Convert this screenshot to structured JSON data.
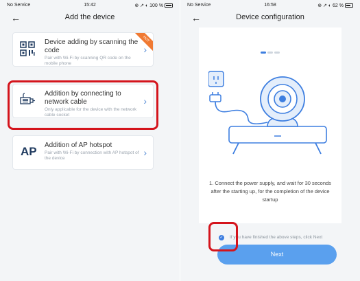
{
  "left_screen": {
    "status": {
      "carrier": "No Service",
      "time": "15:42",
      "battery": "100 %"
    },
    "nav": {
      "back_icon": "back-arrow-icon",
      "title": "Add the device"
    },
    "options": [
      {
        "icon": "qr-code-icon",
        "title": "Device adding by scanning the code",
        "subtitle": "Pair with Wi-Fi by scanning QR code on the mobile phone",
        "badge": "HOT"
      },
      {
        "icon": "network-cable-icon",
        "title": "Addition by connecting to network cable",
        "subtitle": "Only applicable for the device with the network cable socket",
        "highlighted": true
      },
      {
        "icon_text": "AP",
        "title": "Addition of AP hotspot",
        "subtitle": "Pair with Wi-Fi by connection with AP hotspot of the device"
      }
    ]
  },
  "right_screen": {
    "status": {
      "carrier": "No Service",
      "time": "16:58",
      "battery": "62 %"
    },
    "nav": {
      "back_icon": "back-arrow-icon",
      "title": "Device configuration"
    },
    "progress": {
      "current_step": 1,
      "total_steps": 3
    },
    "instruction": "1. Connect the power supply, and wait for 30 seconds after the starting up, for the completion of the device startup",
    "confirm_checkbox": {
      "checked": true,
      "label": "If you have finished the above steps, click Next",
      "highlighted": true
    },
    "next_button": "Next"
  },
  "colors": {
    "accent": "#3d7ee0",
    "button": "#5aa0ee",
    "highlight": "#d4141c",
    "badge": "#f07a33"
  }
}
